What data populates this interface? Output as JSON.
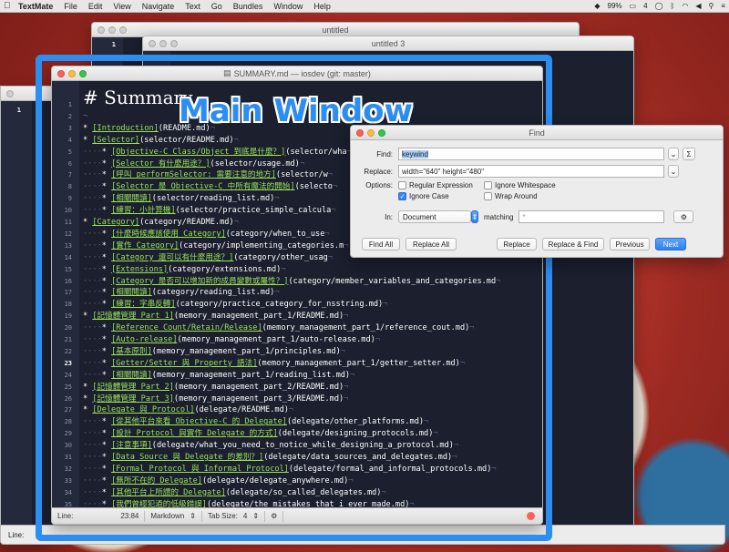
{
  "menubar": {
    "app": "TextMate",
    "items": [
      "File",
      "Edit",
      "View",
      "Navigate",
      "Text",
      "Go",
      "Bundles",
      "Window",
      "Help"
    ],
    "status": [
      "99%",
      "4",
      "Sat 12:34"
    ]
  },
  "bg_windows": {
    "untitled": "untitled",
    "untitled3": "untitled 3",
    "line1": "1",
    "left_line1": "1",
    "left_status": "Line:"
  },
  "main": {
    "title": "SUMMARY.md — iosdev (git: master)",
    "heading": "# Summary",
    "status": {
      "line_label": "Line:",
      "line_value": "23:84",
      "language": "Markdown",
      "tab_size": "Tab Size:",
      "tab_value": "4"
    },
    "lines": [
      {
        "n": "1",
        "text": "# Summary"
      },
      {
        "n": "2",
        "text": ""
      },
      {
        "n": "3",
        "indent": 0,
        "link": "[Introduction]",
        "url": "(README.md)"
      },
      {
        "n": "4",
        "indent": 0,
        "link": "[Selector]",
        "url": "(selector/README.md)"
      },
      {
        "n": "5",
        "indent": 1,
        "link": "[Objective-C Class/Object 到底是什麼？]",
        "url": "(selector/wha"
      },
      {
        "n": "6",
        "indent": 1,
        "link": "[Selector 有什麼用途？]",
        "url": "(selector/usage.md)"
      },
      {
        "n": "7",
        "indent": 1,
        "link": "[呼叫 performSelector: 需要注意的地方]",
        "url": "(selector/w"
      },
      {
        "n": "8",
        "indent": 1,
        "link": "[Selector 是 Objective-C 中所有魔法的開始]",
        "url": "(selecto"
      },
      {
        "n": "9",
        "indent": 1,
        "link": "[相關閱讀]",
        "url": "(selector/reading_list.md)"
      },
      {
        "n": "10",
        "indent": 1,
        "link": "[練習：小計算機]",
        "url": "(selector/practice_simple_calcula"
      },
      {
        "n": "11",
        "indent": 0,
        "link": "[Category]",
        "url": "(category/README.md)"
      },
      {
        "n": "12",
        "indent": 1,
        "link": "[什麼時候應該使用 Category]",
        "url": "(category/when_to_use"
      },
      {
        "n": "13",
        "indent": 1,
        "link": "[實作 Category]",
        "url": "(category/implementing_categories.m"
      },
      {
        "n": "14",
        "indent": 1,
        "link": "[Category 還可以有什麼用途？]",
        "url": "(category/other_usag"
      },
      {
        "n": "15",
        "indent": 1,
        "link": "[Extensions]",
        "url": "(category/extensions.md)"
      },
      {
        "n": "16",
        "indent": 1,
        "link": "[Category 是否可以增加新的成員變數或屬性？]",
        "url": "(category/member_variables_and_categories.md"
      },
      {
        "n": "17",
        "indent": 1,
        "link": "[相關閱讀]",
        "url": "(category/reading_list.md)"
      },
      {
        "n": "18",
        "indent": 1,
        "link": "[練習：字串反轉]",
        "url": "(category/practice_category_for_nsstring.md)"
      },
      {
        "n": "19",
        "indent": 0,
        "link": "[記憶體管理 Part 1]",
        "url": "(memory_management_part_1/README.md)"
      },
      {
        "n": "20",
        "indent": 1,
        "link": "[Reference Count/Retain/Release]",
        "url": "(memory_management_part_1/reference_cout.md)"
      },
      {
        "n": "21",
        "indent": 1,
        "link": "[Auto-release]",
        "url": "(memory_management_part_1/auto-release.md)"
      },
      {
        "n": "22",
        "indent": 1,
        "link": "[基本原則]",
        "url": "(memory_management_part_1/principles.md)"
      },
      {
        "n": "23",
        "indent": 1,
        "link": "[Getter/Setter 與 Property 語法]",
        "url": "(memory_management_part_1/getter_setter.md)"
      },
      {
        "n": "24",
        "indent": 1,
        "link": "[相關閱讀]",
        "url": "(memory_management_part_1/reading_list.md)"
      },
      {
        "n": "25",
        "indent": 0,
        "link": "[記憶體管理 Part 2]",
        "url": "(memory_management_part_2/README.md)"
      },
      {
        "n": "26",
        "indent": 0,
        "link": "[記憶體管理 Part 3]",
        "url": "(memory_management_part_3/README.md)"
      },
      {
        "n": "27",
        "indent": 0,
        "link": "[Delegate 與 Protocol]",
        "url": "(delegate/README.md)"
      },
      {
        "n": "28",
        "indent": 1,
        "link": "[從其他平台來看 Objective-C 的 Delegate]",
        "url": "(delegate/other_platforms.md)"
      },
      {
        "n": "29",
        "indent": 1,
        "link": "[設計 Protocol 與實作 Delegate 的方式]",
        "url": "(delegate/designing_protocols.md)"
      },
      {
        "n": "30",
        "indent": 1,
        "link": "[注意事項]",
        "url": "(delegate/what_you_need_to_notice_while_designing_a_protocol.md)"
      },
      {
        "n": "31",
        "indent": 1,
        "link": "[Data Source 與 Delegate 的差別？]",
        "url": "(delegate/data_sources_and_delegates.md)"
      },
      {
        "n": "32",
        "indent": 1,
        "link": "[Formal Protocol 與 Informal Protocol]",
        "url": "(delegate/formal_and_informal_protocols.md)"
      },
      {
        "n": "33",
        "indent": 1,
        "link": "[無所不在的 Delegate]",
        "url": "(delegate/delegate_anywhere.md)"
      },
      {
        "n": "34",
        "indent": 1,
        "link": "[其他平台上所謂的 Delegate]",
        "url": "(delegate/so_called_delegates.md)"
      },
      {
        "n": "35",
        "indent": 1,
        "link": "[我們曾經犯過的低級錯誤]",
        "url": "(delegate/the_mistakes_that_i_ever_made.md)"
      },
      {
        "n": "36",
        "indent": 0,
        "link": "",
        "url": ""
      }
    ],
    "current_line": "23"
  },
  "overlay": {
    "label": "Main Window"
  },
  "find": {
    "title": "Find",
    "find_label": "Find:",
    "find_value": "keywind",
    "sigma": "Σ",
    "replace_label": "Replace:",
    "replace_value": "width=\"640\" height=\"480\"",
    "options_label": "Options:",
    "opt_regex": "Regular Expression",
    "opt_ignore_ws": "Ignore Whitespace",
    "opt_ignore_case": "Ignore Case",
    "opt_wrap": "Wrap Around",
    "in_label": "In:",
    "in_value": "Document",
    "matching_label": "matching",
    "matching_value": "*",
    "btn_find_all": "Find All",
    "btn_replace_all": "Replace All",
    "btn_replace": "Replace",
    "btn_replace_find": "Replace & Find",
    "btn_previous": "Previous",
    "btn_next": "Next"
  }
}
